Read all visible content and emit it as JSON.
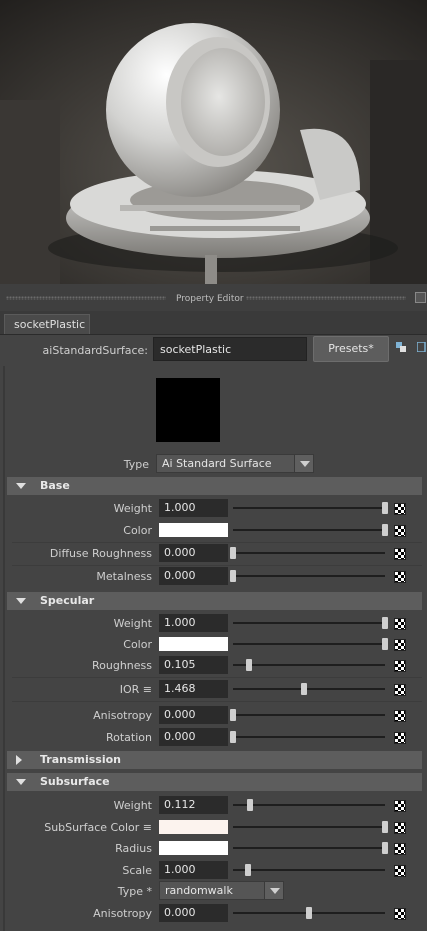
{
  "panel": {
    "title": "Property Editor",
    "tab_label": "socketPlastic"
  },
  "shader": {
    "type_label": "aiStandardSurface:",
    "name": "socketPlastic",
    "presets_label": "Presets*"
  },
  "type_row": {
    "label": "Type",
    "value": "Ai Standard Surface"
  },
  "sections": {
    "base": {
      "title": "Base",
      "rows": [
        {
          "label": "Weight",
          "value": "1.000",
          "fraction": 1.0
        },
        {
          "label": "Color",
          "value": "",
          "color": "#ffffff",
          "fraction": 1.0
        },
        {
          "label": "Diffuse Roughness",
          "value": "0.000",
          "fraction": 0.0
        },
        {
          "label": "Metalness",
          "value": "0.000",
          "fraction": 0.0
        }
      ]
    },
    "specular": {
      "title": "Specular",
      "rows": [
        {
          "label": "Weight",
          "value": "1.000",
          "fraction": 1.0
        },
        {
          "label": "Color",
          "value": "",
          "color": "#ffffff",
          "fraction": 1.0
        },
        {
          "label": "Roughness",
          "value": "0.105",
          "fraction": 0.105
        },
        {
          "label": "IOR ≡",
          "value": "1.468",
          "fraction": 0.47
        },
        {
          "label": "Anisotropy",
          "value": "0.000",
          "fraction": 0.0
        },
        {
          "label": "Rotation",
          "value": "0.000",
          "fraction": 0.0
        }
      ]
    },
    "transmission": {
      "title": "Transmission"
    },
    "subsurface": {
      "title": "Subsurface",
      "rows": [
        {
          "label": "Weight",
          "value": "0.112",
          "fraction": 0.112
        },
        {
          "label": "SubSurface Color ≡",
          "value": "",
          "color": "#fcf3ee",
          "fraction": 1.0
        },
        {
          "label": "Radius",
          "value": "",
          "color": "#ffffff",
          "fraction": 1.0
        },
        {
          "label": "Scale",
          "value": "1.000",
          "fraction": 0.1
        }
      ],
      "type_label": "Type *",
      "type_value": "randomwalk",
      "anisotropy": {
        "label": "Anisotropy",
        "value": "0.000",
        "fraction": 0.5
      }
    }
  }
}
